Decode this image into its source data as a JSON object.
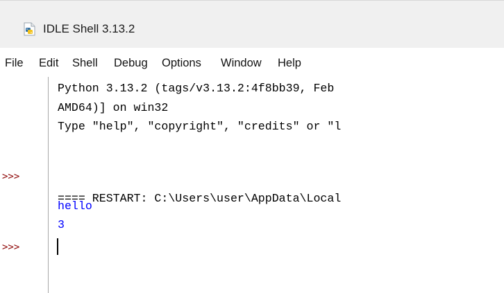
{
  "window": {
    "title": "IDLE Shell 3.13.2",
    "app_icon": "python-idle-icon"
  },
  "menu": {
    "items": [
      "File",
      "Edit",
      "Shell",
      "Debug",
      "Options",
      "Window",
      "Help"
    ]
  },
  "shell": {
    "prompt": ">>>",
    "lines": [
      "Python 3.13.2 (tags/v3.13.2:4f8bb39, Feb",
      "AMD64)] on win32",
      "Type \"help\", \"copyright\", \"credits\" or \"l",
      "==== RESTART: C:\\Users\\user\\AppData\\Local",
      "hello",
      "3"
    ]
  },
  "colors": {
    "prompt": "#8b0000",
    "output": "#0000ff",
    "text": "#000000"
  }
}
